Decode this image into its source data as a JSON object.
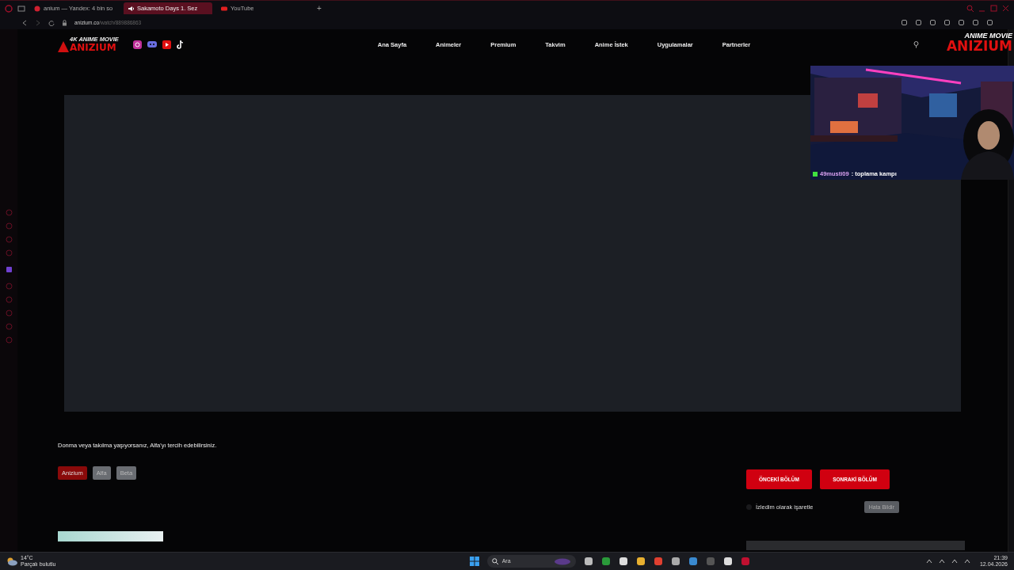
{
  "browser": {
    "tabs": [
      {
        "title": "anium — Yandex: 4 bin so",
        "selected": false,
        "kind": "search"
      },
      {
        "title": "Sakamoto Days 1. Sez",
        "selected": true,
        "kind": "audio"
      },
      {
        "title": "YouTube",
        "selected": false,
        "kind": "video"
      }
    ],
    "new_tab_symbol": "+",
    "url_host": "anizium.co",
    "url_path": "/watch/889886863"
  },
  "site": {
    "logo": {
      "tagline": "4K ANIME MOVIE",
      "name": "ANIZIUM"
    },
    "nav": [
      "Ana Sayfa",
      "Animeler",
      "Premium",
      "Takvim",
      "Anime İstek",
      "Uygulamalar",
      "Partnerler"
    ],
    "notice": "Donma veya takılma yaşıyorsanız, Alfa'yı tercih edebilirsiniz.",
    "sources": [
      {
        "label": "Anizium",
        "selected": true
      },
      {
        "label": "Alfa",
        "selected": false
      },
      {
        "label": "Beta",
        "selected": false
      }
    ],
    "episode_buttons": [
      "ÖNCEKİ BÖLÜM",
      "SONRAKİ BÖLÜM"
    ],
    "watched": {
      "label": "İzledim olarak işaretle",
      "checked": false
    },
    "report_button": "Hata Bildir"
  },
  "stream_overlay": {
    "logo": {
      "tagline": "ANIME MOVIE",
      "name": "ANIZIUM"
    },
    "chat": {
      "user": "49musti09",
      "message": ": toplama kampı"
    }
  },
  "taskbar": {
    "weather": {
      "temp": "14°C",
      "condition": "Parçalı bulutlu"
    },
    "search_placeholder": "Ara",
    "time": "21:39",
    "date": "12.04.2026"
  }
}
